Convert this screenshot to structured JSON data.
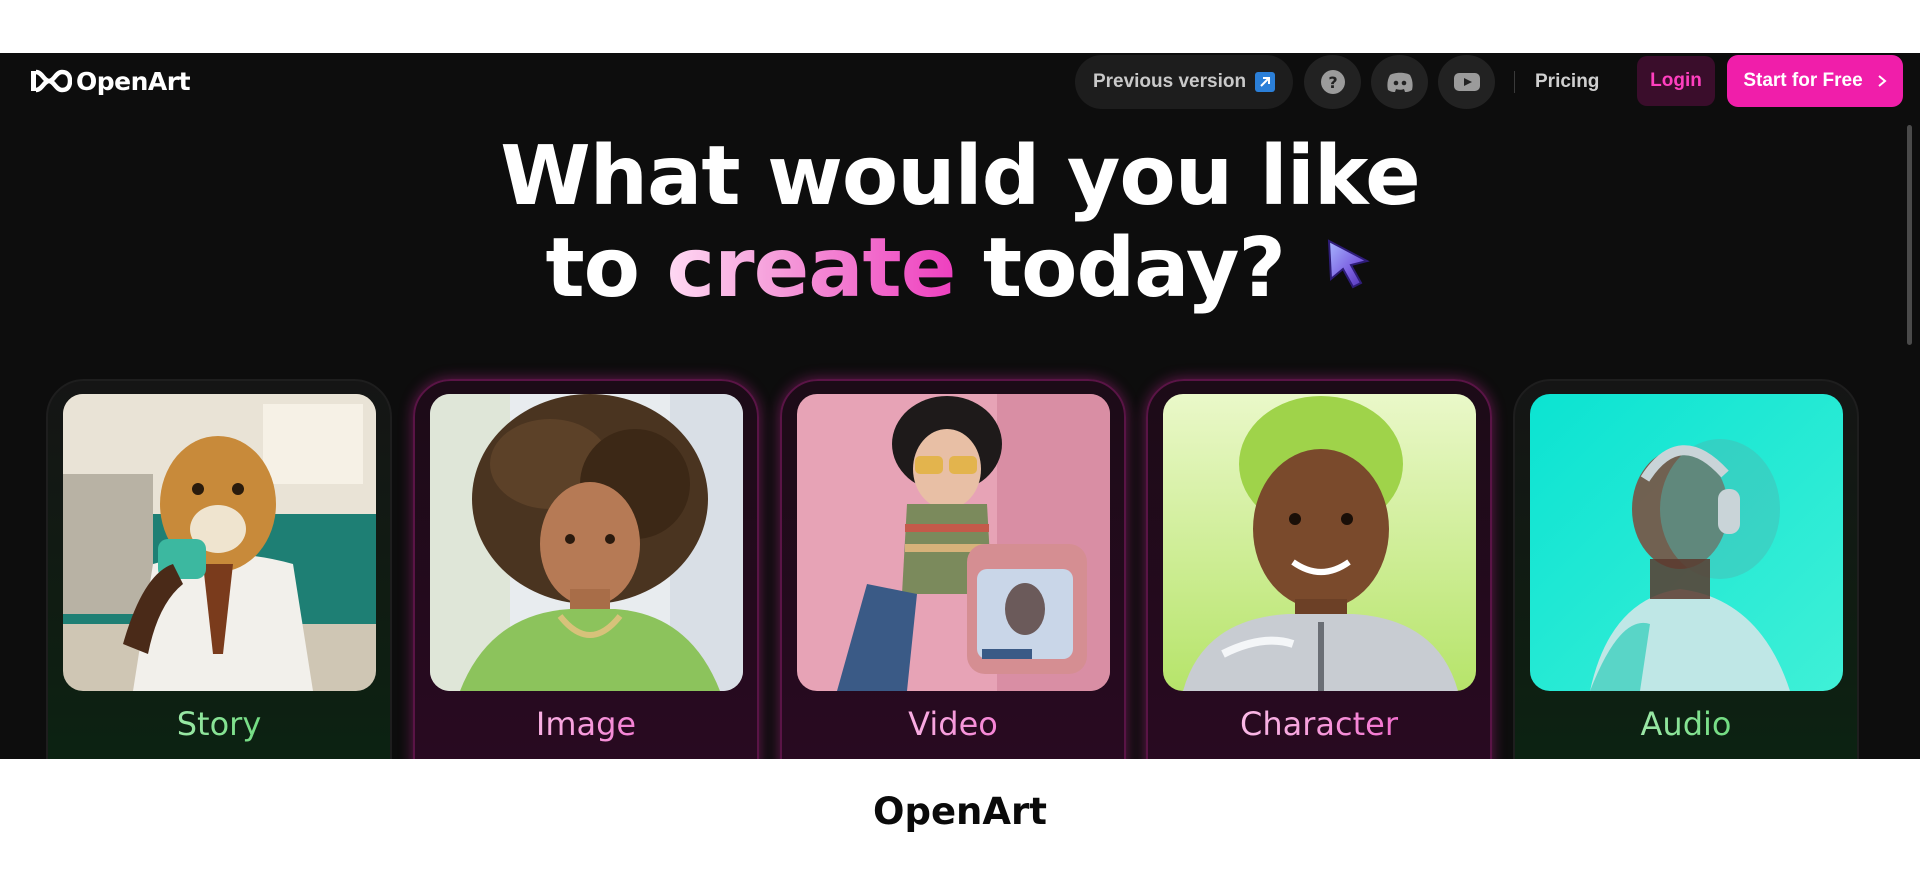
{
  "app": {
    "brand": "OpenArt",
    "header": {
      "previous_version_label": "Previous version",
      "pricing_label": "Pricing",
      "login_label": "Login",
      "start_label": "Start for Free"
    },
    "hero": {
      "line1": "What would you like",
      "line2_prefix": "to",
      "line2_highlight": "create",
      "line2_suffix": "today?"
    },
    "cards": [
      {
        "label": "Story",
        "accent": "green"
      },
      {
        "label": "Image",
        "accent": "pink"
      },
      {
        "label": "Video",
        "accent": "pink"
      },
      {
        "label": "Character",
        "accent": "pink"
      },
      {
        "label": "Audio",
        "accent": "green"
      }
    ]
  },
  "caption": "OpenArt",
  "icons": [
    "infinity-logo-icon",
    "external-link-icon",
    "help-icon",
    "discord-icon",
    "youtube-icon",
    "chevron-right-icon",
    "cursor-icon"
  ],
  "colors": {
    "brand_pink": "#f01eaa",
    "background": "#0d0d0d",
    "green_accent": "#35c64c"
  }
}
